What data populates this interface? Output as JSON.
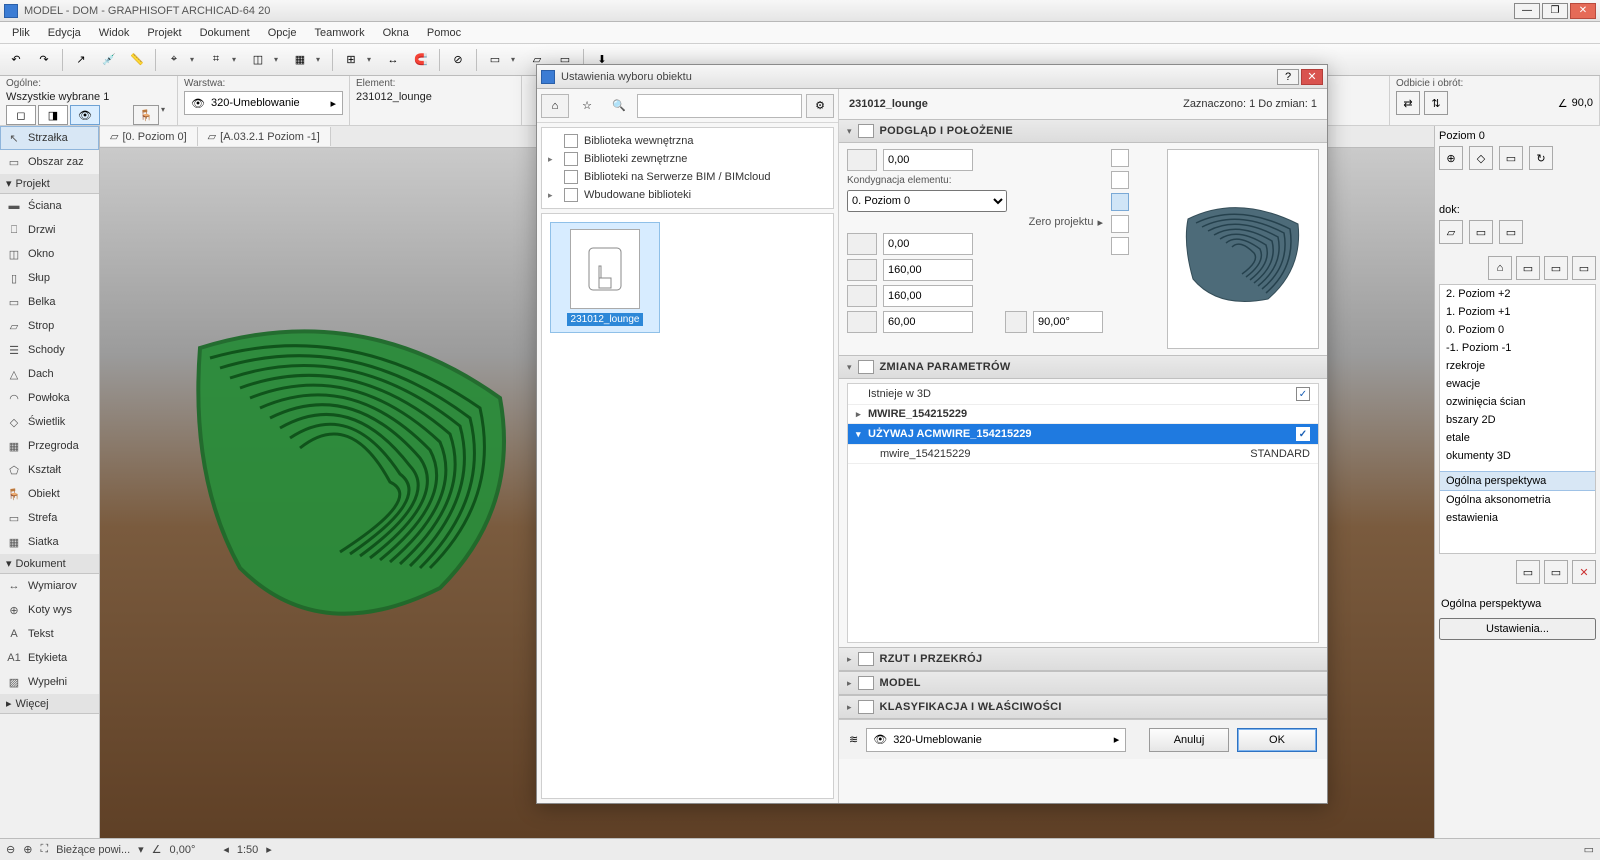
{
  "window": {
    "title": "MODEL - DOM - GRAPHISOFT ARCHICAD-64 20",
    "minimize": "—",
    "maximize": "❐",
    "close": "✕"
  },
  "menu": [
    "Plik",
    "Edycja",
    "Widok",
    "Projekt",
    "Dokument",
    "Opcje",
    "Teamwork",
    "Okna",
    "Pomoc"
  ],
  "inforow": {
    "general_label": "Ogólne:",
    "general_text": "Wszystkie wybrane 1",
    "layer_label": "Warstwa:",
    "layer_value": "320-Umeblowanie",
    "element_label": "Element:",
    "element_value": "231012_lounge"
  },
  "viewtabs": {
    "tab1": "[0. Poziom 0]",
    "tab2": "[A.03.2.1 Poziom -1]"
  },
  "toolbox": {
    "arrow": "Strzałka",
    "marquee": "Obszar zaz",
    "section_project": "Projekt",
    "wall": "Ściana",
    "door": "Drzwi",
    "window": "Okno",
    "column": "Słup",
    "beam": "Belka",
    "slab": "Strop",
    "stair": "Schody",
    "roof": "Dach",
    "shell": "Powłoka",
    "skylight": "Świetlik",
    "curtain": "Przegroda",
    "morph": "Kształt",
    "object": "Obiekt",
    "zone": "Strefa",
    "mesh": "Siatka",
    "section_document": "Dokument",
    "dim": "Wymiarov",
    "level": "Koty wys",
    "text": "Tekst",
    "label": "Etykieta",
    "fill": "Wypełni",
    "more": "Więcej"
  },
  "rightpanel": {
    "poziom_label": "Poziom 0",
    "angle_label": "90,0",
    "rotate_label": "Odbicie i obrót:",
    "dok_label": "dok:",
    "levels": [
      "2. Poziom +2",
      "1. Poziom +1",
      "0. Poziom 0",
      "-1. Poziom -1",
      "rzekroje",
      "ewacje",
      "ozwinięcia ścian",
      "bszary 2D",
      "etale",
      "okumenty 3D"
    ],
    "persp1": "Ogólna perspektywa",
    "persp2": "Ogólna aksonometria",
    "settings_item": "estawienia",
    "footer_persp": "Ogólna perspektywa",
    "footer_settings": "Ustawienia..."
  },
  "status": {
    "field": "Bieżące powi...",
    "coord": "0,00°",
    "scale": "1:50"
  },
  "dialog": {
    "title": "Ustawienia wyboru obiektu",
    "help": "?",
    "close": "✕",
    "selected_name": "231012_lounge",
    "selection_info": "Zaznaczono: 1 Do zmian: 1",
    "tree": {
      "n1": "Biblioteka wewnętrzna",
      "n2": "Biblioteki zewnętrzne",
      "n3": "Biblioteki na Serwerze BIM / BIMcloud",
      "n4": "Wbudowane biblioteki"
    },
    "thumb_label": "231012_lounge",
    "sections": {
      "s1": "PODGLĄD I POŁOŻENIE",
      "s2": "ZMIANA PARAMETRÓW",
      "s3": "RZUT I PRZEKRÓJ",
      "s4": "MODEL",
      "s5": "KLASYFIKACJA I WŁAŚCIWOŚCI"
    },
    "position": {
      "z_top": "0,00",
      "story_label": "Kondygnacja elementu:",
      "story_value": "0. Poziom 0",
      "zero_label": "Zero projektu",
      "z_bottom": "0,00",
      "dim_x": "160,00",
      "dim_y": "160,00",
      "dim_z": "60,00",
      "angle": "90,00°"
    },
    "params": {
      "exists3d": "Istnieje w 3D",
      "mwire": "MWIRE_154215229",
      "use_acm": "UŻYWAJ ACMWIRE_154215229",
      "row_key": "mwire_154215229",
      "row_val": "STANDARD",
      "check": "✓"
    },
    "bottom": {
      "layer": "320-Umeblowanie",
      "cancel": "Anuluj",
      "ok": "OK"
    }
  }
}
